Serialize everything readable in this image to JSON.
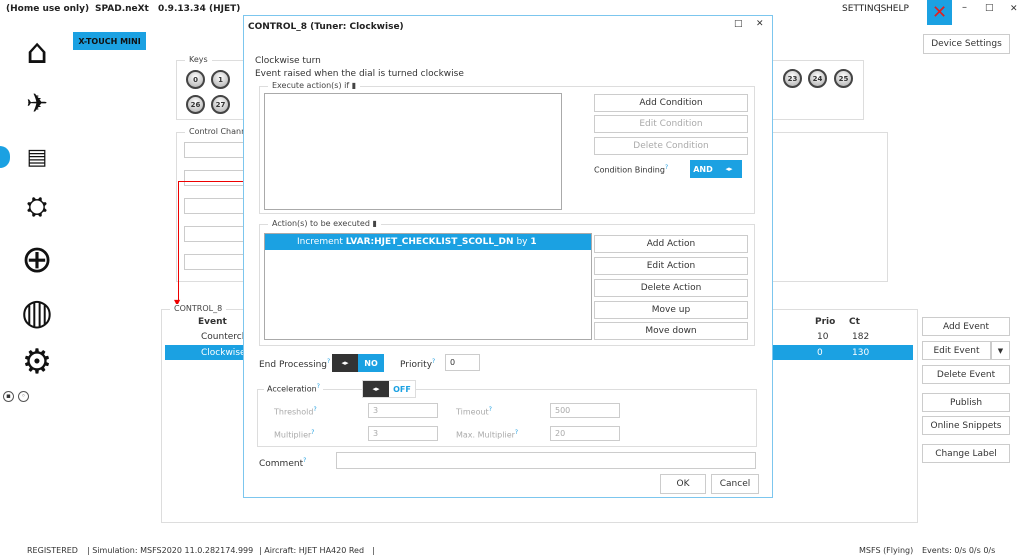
{
  "app": {
    "edition": "(Home use only)",
    "name": "SPAD.neXt",
    "version": "0.9.13.34 (HJET)",
    "settings": "SETTINGS",
    "sep": "|",
    "help": "HELP"
  },
  "device": {
    "name": "X-TOUCH MINI",
    "settings_button": "Device Settings"
  },
  "keys": {
    "label": "Keys",
    "row1_left": [
      "0",
      "1"
    ],
    "row1_right": [
      "23",
      "24",
      "25"
    ],
    "row2": [
      "26",
      "27"
    ]
  },
  "control_channel": {
    "label": "Control Channe"
  },
  "control": {
    "label": "CONTROL_8",
    "columns": [
      "Event",
      "Prio",
      "Ct"
    ],
    "rows": [
      {
        "event": "Countercl",
        "prio": "10",
        "ct": "182",
        "selected": false
      },
      {
        "event": "Clockwise",
        "prio": "0",
        "ct": "130",
        "selected": true
      }
    ]
  },
  "right_buttons": {
    "add_event": "Add Event",
    "edit_event": "Edit Event",
    "delete_event": "Delete Event",
    "publish": "Publish",
    "online_snippets": "Online Snippets",
    "change_label": "Change Label"
  },
  "dialog": {
    "title": "CONTROL_8 (Tuner: Clockwise)",
    "heading": "Clockwise turn",
    "description": "Event raised when the dial is turned clockwise",
    "conditions": {
      "label": "Execute action(s) if",
      "add": "Add Condition",
      "edit": "Edit Condition",
      "delete": "Delete Condition",
      "binding_label": "Condition Binding",
      "binding_value": "AND"
    },
    "actions": {
      "label": "Action(s) to be executed",
      "items": [
        {
          "prefix": "Increment",
          "target": "LVAR:HJET_CHECKLIST_SCOLL_DN",
          "by": "by",
          "value": "1"
        }
      ],
      "add": "Add Action",
      "edit": "Edit Action",
      "delete": "Delete Action",
      "up": "Move up",
      "down": "Move down"
    },
    "end_processing": {
      "label": "End Processing",
      "value": "NO"
    },
    "priority": {
      "label": "Priority",
      "value": "0"
    },
    "acceleration": {
      "label": "Acceleration",
      "value": "OFF",
      "threshold_label": "Threshold",
      "threshold": "3",
      "timeout_label": "Timeout",
      "timeout": "500",
      "multiplier_label": "Multiplier",
      "multiplier": "3",
      "max_multiplier_label": "Max. Multiplier",
      "max_multiplier": "20"
    },
    "comment": {
      "label": "Comment",
      "value": ""
    },
    "ok": "OK",
    "cancel": "Cancel"
  },
  "status": {
    "registered": "REGISTERED",
    "simulation": "| Simulation: MSFS2020 11.0.282174.999",
    "aircraft": "| Aircraft: HJET HA420 Red",
    "sep": "|",
    "sim_state": "MSFS (Flying)",
    "events": "Events: 0/s 0/s 0/s"
  },
  "colors": {
    "accent": "#1ba1e2",
    "selected_row": "#1ba1e2",
    "dialog_border": "#7cc6ee",
    "link_line": "#e00000"
  }
}
